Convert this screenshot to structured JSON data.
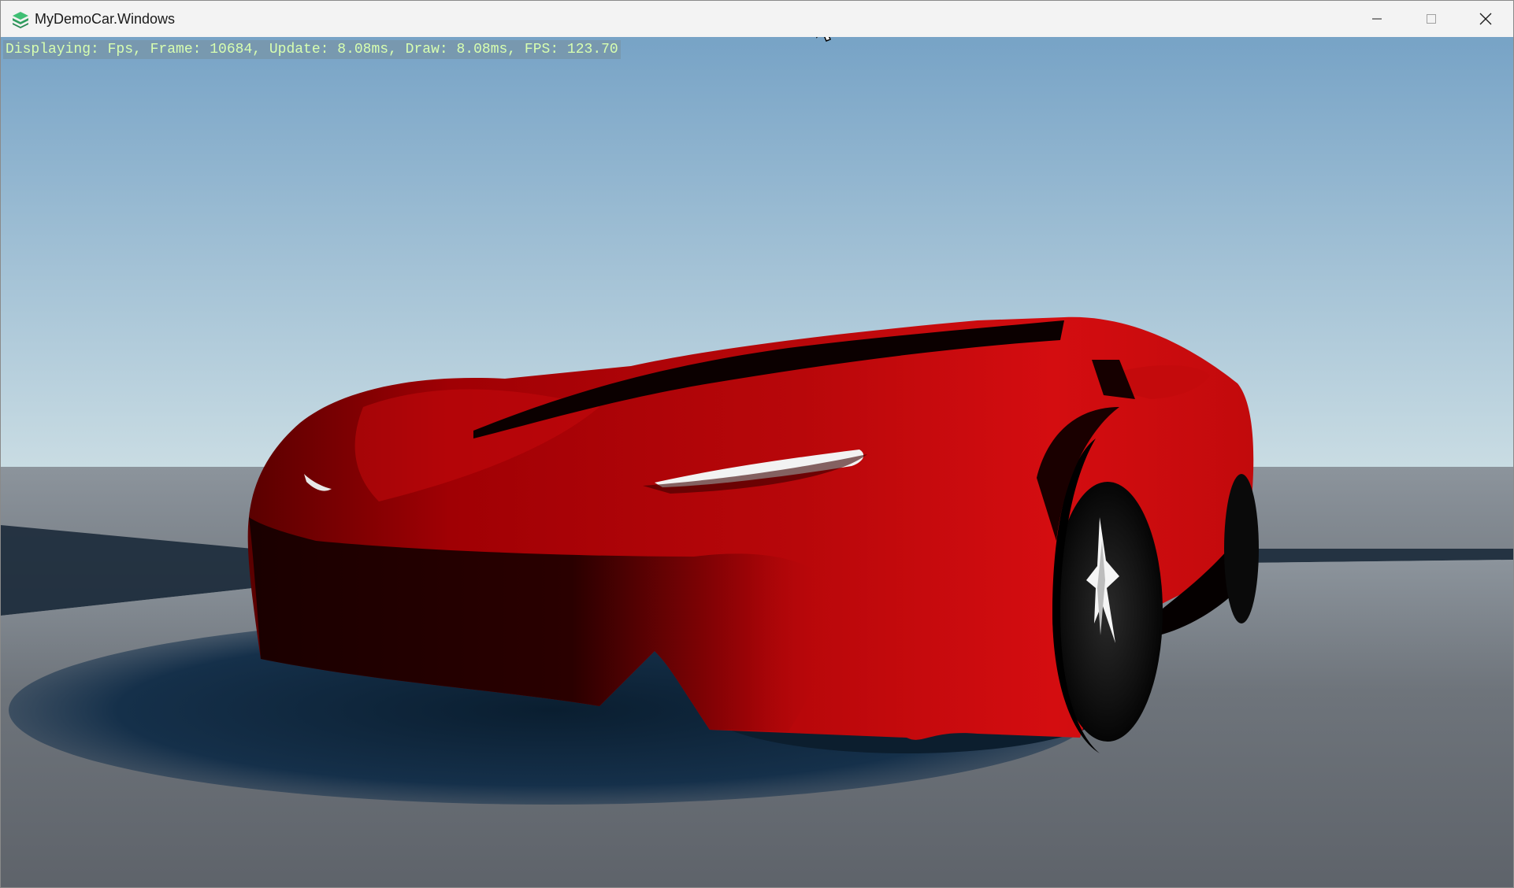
{
  "window": {
    "title": "MyDemoCar.Windows",
    "icon": "stride-logo-icon",
    "controls": [
      "minimize-icon",
      "maximize-icon",
      "close-icon"
    ]
  },
  "overlay": {
    "stats_text": "Displaying: Fps, Frame: 10684, Update: 8.08ms, Draw: 8.08ms, FPS: 123.70"
  },
  "scene": {
    "sky_top_color": "#77a3c6",
    "sky_horizon_color": "#c8dbe2",
    "ground_color": "#6a6f76",
    "car_color": "#c80a0c"
  }
}
